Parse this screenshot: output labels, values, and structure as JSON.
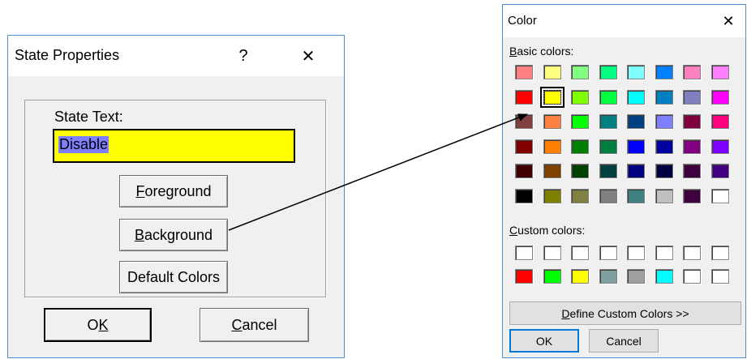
{
  "state_dialog": {
    "title": "State Properties",
    "help_glyph": "?",
    "close_glyph": "✕",
    "state_text_label": "State Text:",
    "state_text_value": "Disable",
    "foreground_prefix": "",
    "foreground_u": "F",
    "foreground_rest": "oreground",
    "background_prefix": "",
    "background_u": "B",
    "background_rest": "ackground",
    "default_colors_label": "Default Colors",
    "ok_prefix": "O",
    "ok_u": "K",
    "cancel_u": "C",
    "cancel_rest": "ancel",
    "text_bg_color": "#ffff00"
  },
  "color_dialog": {
    "title": "Color",
    "close_glyph": "✕",
    "basic_colors_u": "B",
    "basic_colors_rest": "asic colors:",
    "custom_colors_u": "C",
    "custom_colors_rest": "ustom colors:",
    "define_prefix": "",
    "define_u": "D",
    "define_rest": "efine Custom Colors >>",
    "ok_label": "OK",
    "cancel_label": "Cancel",
    "selected_basic_index": 9,
    "basic_colors": [
      "#ff8080",
      "#ffff80",
      "#80ff80",
      "#00ff80",
      "#80ffff",
      "#0080ff",
      "#ff80c0",
      "#ff80ff",
      "#ff0000",
      "#ffff00",
      "#80ff00",
      "#00ff40",
      "#00ffff",
      "#0080c0",
      "#8080c0",
      "#ff00ff",
      "#804040",
      "#ff8040",
      "#00ff00",
      "#008080",
      "#004080",
      "#8080ff",
      "#800040",
      "#ff0080",
      "#800000",
      "#ff8000",
      "#008000",
      "#008040",
      "#0000ff",
      "#0000a0",
      "#800080",
      "#8000ff",
      "#400000",
      "#804000",
      "#004000",
      "#004040",
      "#000080",
      "#000040",
      "#400040",
      "#400080",
      "#000000",
      "#808000",
      "#808040",
      "#808080",
      "#408080",
      "#c0c0c0",
      "#400040",
      "#ffffff"
    ],
    "custom_colors": [
      "#ffffff",
      "#ffffff",
      "#ffffff",
      "#ffffff",
      "#ffffff",
      "#ffffff",
      "#ffffff",
      "#ffffff",
      "#ff0000",
      "#00ff00",
      "#ffff00",
      "#80a0a0",
      "#a0a0a0",
      "#00ffff",
      "#ffffff",
      "#ffffff"
    ]
  }
}
